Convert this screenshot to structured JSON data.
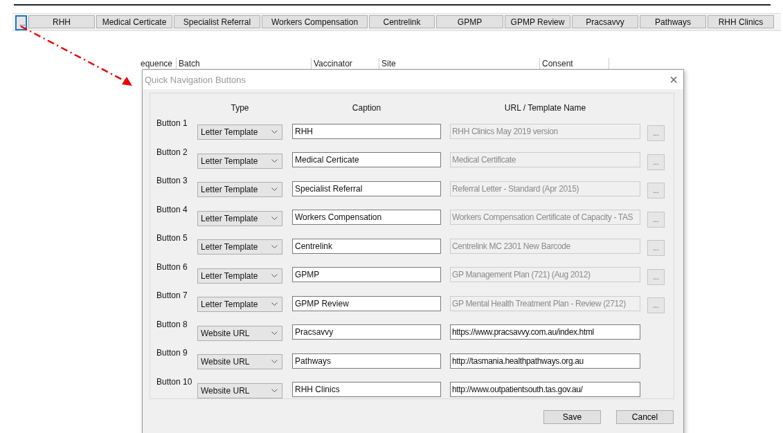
{
  "toolbar": {
    "buttons": [
      {
        "label": "...",
        "selected": true
      },
      {
        "label": "RHH",
        "selected": false
      },
      {
        "label": "Medical Certicate",
        "selected": false
      },
      {
        "label": "Specialist Referral",
        "selected": false
      },
      {
        "label": "Workers Compensation",
        "selected": false
      },
      {
        "label": "Centrelink",
        "selected": false
      },
      {
        "label": "GPMP",
        "selected": false
      },
      {
        "label": "GPMP Review",
        "selected": false
      },
      {
        "label": "Pracsavvy",
        "selected": false
      },
      {
        "label": "Pathways",
        "selected": false
      },
      {
        "label": "RHH Clinics",
        "selected": false
      }
    ]
  },
  "background_table": {
    "columns": [
      "equence",
      "Batch",
      "Vaccinator",
      "Site",
      "Consent"
    ]
  },
  "dialog": {
    "title": "Quick Navigation Buttons",
    "close": "×",
    "columns": [
      "Type",
      "Caption",
      "URL / Template Name"
    ],
    "rows": [
      {
        "label": "Button 1",
        "type": "Letter Template",
        "caption": "RHH",
        "url": "RHH Clinics May 2019 version",
        "disabled": true,
        "browse": "..."
      },
      {
        "label": "Button 2",
        "type": "Letter Template",
        "caption": "Medical Certicate",
        "url": "Medical Certificate",
        "disabled": true,
        "browse": "..."
      },
      {
        "label": "Button 3",
        "type": "Letter Template",
        "caption": "Specialist Referral",
        "url": "Referral Letter - Standard (Apr 2015)",
        "disabled": true,
        "browse": "..."
      },
      {
        "label": "Button 4",
        "type": "Letter Template",
        "caption": "Workers Compensation",
        "url": "Workers Compensation Certificate of Capacity - TAS",
        "disabled": true,
        "browse": "..."
      },
      {
        "label": "Button 5",
        "type": "Letter Template",
        "caption": "Centrelink",
        "url": "Centrelink MC 2301 New Barcode",
        "disabled": true,
        "browse": "..."
      },
      {
        "label": "Button 6",
        "type": "Letter Template",
        "caption": "GPMP",
        "url": "GP Management Plan (721) (Aug 2012)",
        "disabled": true,
        "browse": "..."
      },
      {
        "label": "Button 7",
        "type": "Letter Template",
        "caption": "GPMP Review",
        "url": "GP Mental Health Treatment Plan - Review (2712)",
        "disabled": true,
        "browse": "..."
      },
      {
        "label": "Button 8",
        "type": "Website URL",
        "caption": "Pracsavvy",
        "url": "https://www.pracsavvy.com.au/index.html",
        "disabled": false
      },
      {
        "label": "Button 9",
        "type": "Website URL",
        "caption": "Pathways",
        "url": "http://tasmania.healthpathways.org.au",
        "disabled": false
      },
      {
        "label": "Button 10",
        "type": "Website URL",
        "caption": "RHH Clinics",
        "url": "http://www.outpatientsouth.tas.gov.au/",
        "disabled": false
      }
    ],
    "buttons": [
      "Save",
      "Cancel"
    ]
  }
}
